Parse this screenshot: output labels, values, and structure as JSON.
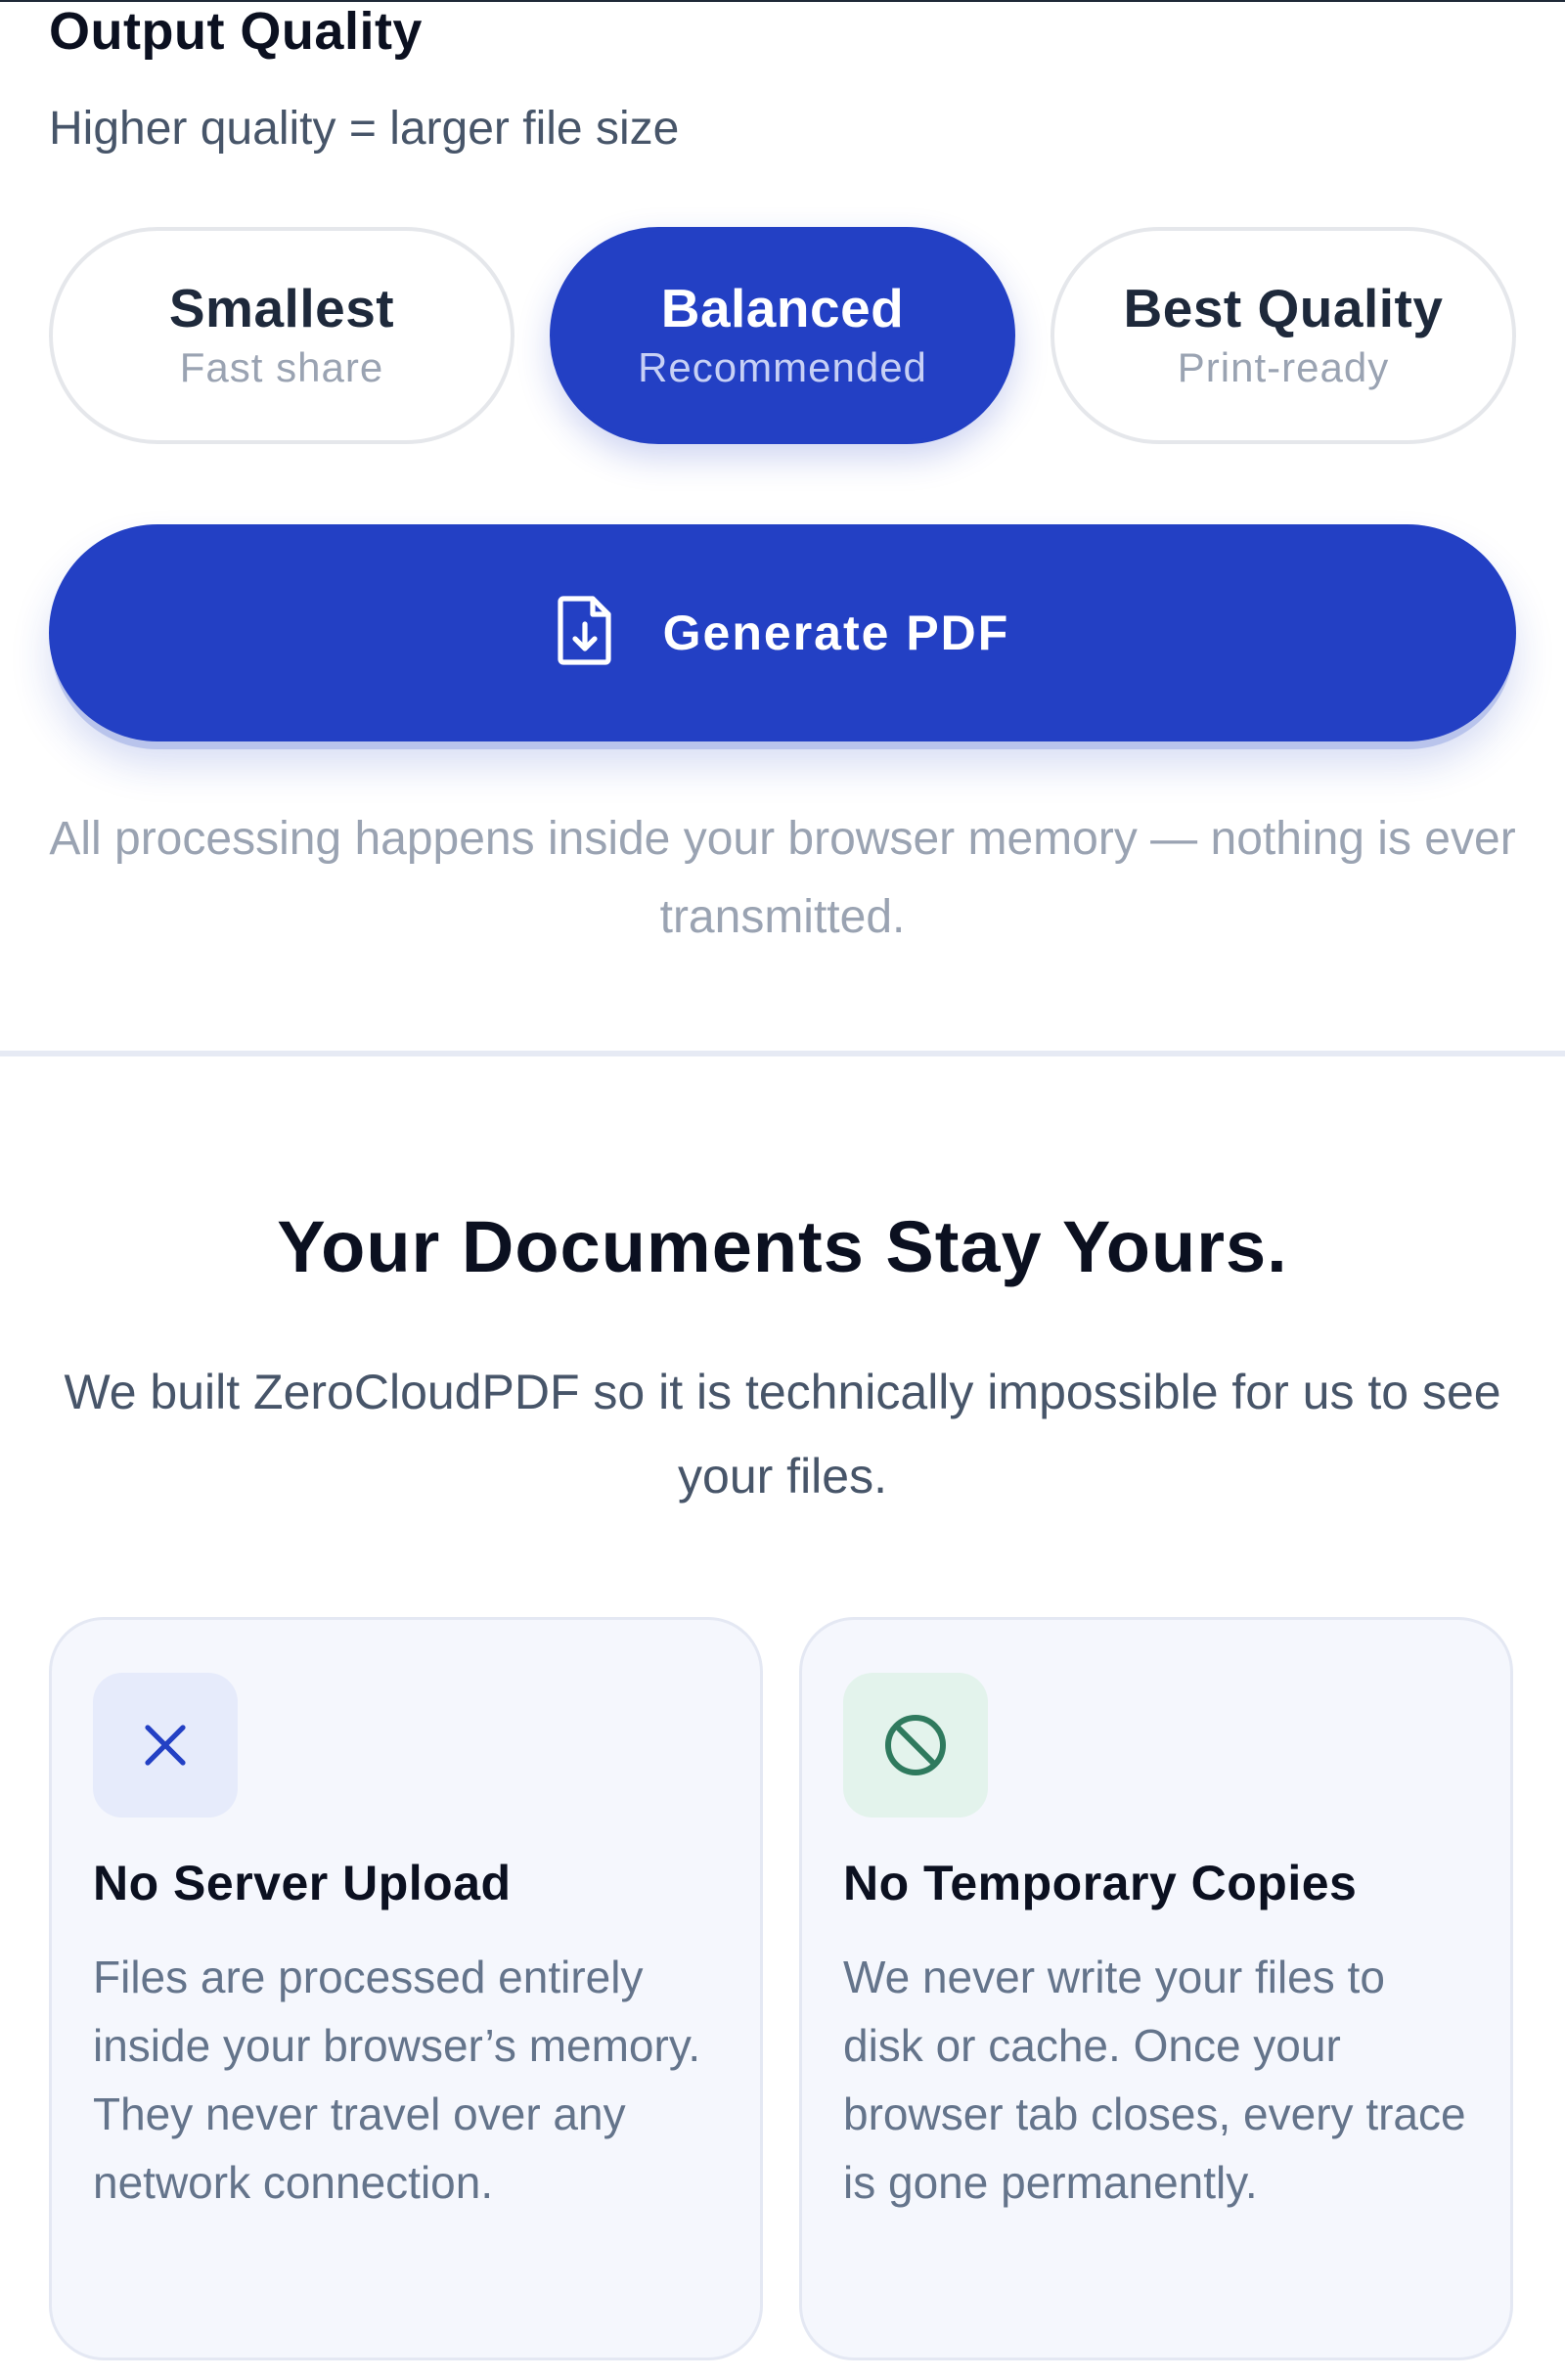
{
  "output_quality": {
    "title": "Output Quality",
    "subtitle": "Higher quality = larger file size",
    "options": [
      {
        "label": "Smallest",
        "sub": "Fast share"
      },
      {
        "label": "Balanced",
        "sub": "Recommended"
      },
      {
        "label": "Best Quality",
        "sub": "Print-ready"
      }
    ],
    "selected": "Balanced"
  },
  "generate": {
    "label": "Generate PDF",
    "icon": "file-download-icon"
  },
  "privacy_note": "All processing happens inside your browser memory — nothing is ever transmitted.",
  "privacy": {
    "heading": "Your Documents Stay Yours.",
    "description": "We built ZeroCloudPDF so it is technically impossible for us to see your files.",
    "cards": [
      {
        "icon": "close-icon",
        "title": "No Server Upload",
        "body": "Files are processed entirely inside your browser’s memory. They never travel over any network connection."
      },
      {
        "icon": "prohibited-icon",
        "title": "No Temporary Copies",
        "body": "We never write your files to disk or cache. Once your browser tab closes, every trace is gone permanently."
      }
    ]
  },
  "colors": {
    "accent": "#2340c4",
    "x_icon": "#2340c4",
    "ban_icon": "#2f7a5e"
  }
}
